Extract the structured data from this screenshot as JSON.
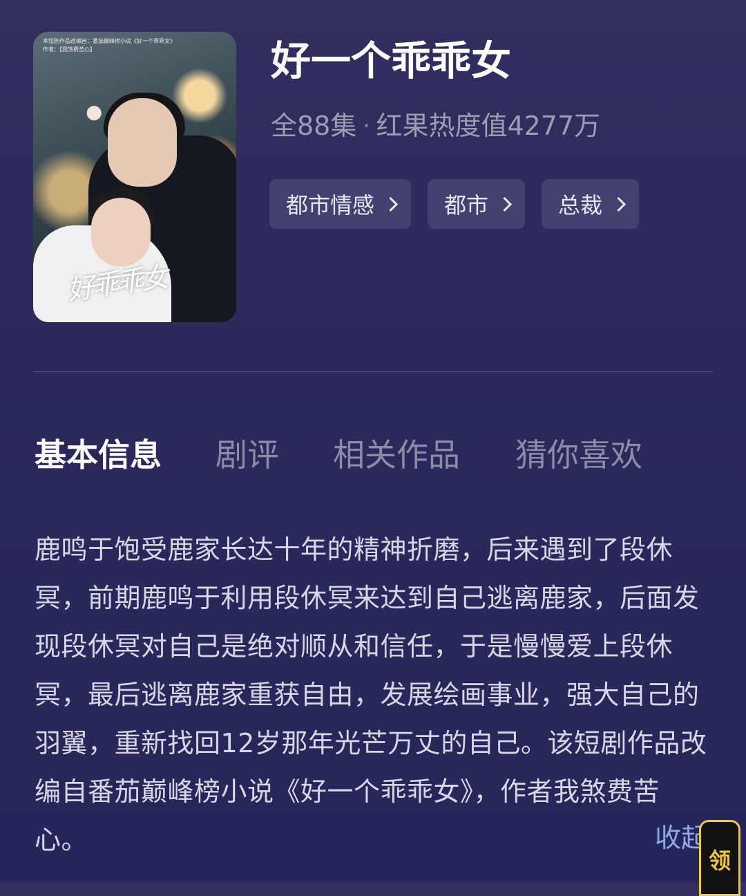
{
  "poster": {
    "credit": "本短剧作品改编自：番茄巅峰榜小说《好一个乖乖女》\n作者：【我煞费苦心】",
    "logo_text": "好乖乖女"
  },
  "drama": {
    "title": "好一个乖乖女",
    "episodes": "全88集",
    "separator": "·",
    "heat": "红果热度值4277万"
  },
  "tags": [
    "都市情感",
    "都市",
    "总裁"
  ],
  "tabs": [
    "基本信息",
    "剧评",
    "相关作品",
    "猜你喜欢"
  ],
  "description": "鹿鸣于饱受鹿家长达十年的精神折磨，后来遇到了段休冥，前期鹿鸣于利用段休冥来达到自己逃离鹿家，后面发现段休冥对自己是绝对顺从和信任，于是慢慢爱上段休冥，最后逃离鹿家重获自由，发展绘画事业，强大自己的羽翼，重新找回12岁那年光芒万丈的自己。该短剧作品改编自番茄巅峰榜小说《好一个乖乖女》，作者我煞费苦心。",
  "collapse_label": "收起",
  "reward_label": "领"
}
